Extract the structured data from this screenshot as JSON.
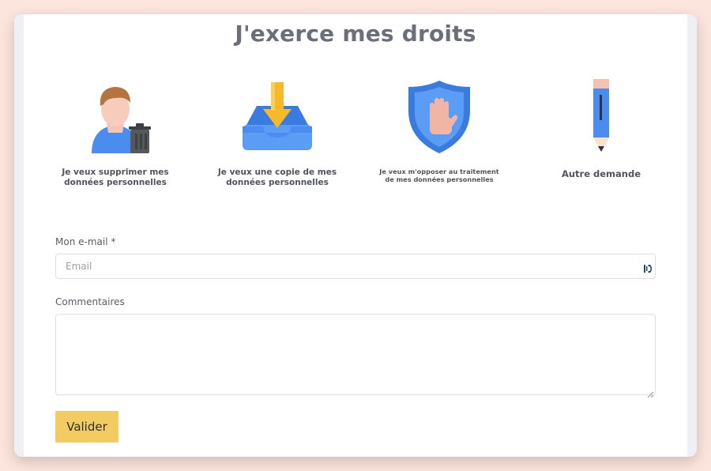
{
  "page": {
    "title": "J'exerce mes droits"
  },
  "options": [
    {
      "label_line1": "Je veux supprimer mes",
      "label_line2": "données personnelles",
      "icon": "delete-user-icon"
    },
    {
      "label_line1": "Je veux une copie de mes",
      "label_line2": "données personnelles",
      "icon": "download-tray-icon"
    },
    {
      "label_line1": "Je veux m'opposer au traitement",
      "label_line2": "de mes données personnelles",
      "icon": "stop-shield-icon"
    },
    {
      "label_line1": "Autre demande",
      "label_line2": "",
      "icon": "pencil-icon"
    }
  ],
  "form": {
    "email_label": "Mon e-mail *",
    "email_placeholder": "Email",
    "email_value": "",
    "comments_label": "Commentaires",
    "comments_value": "",
    "submit_label": "Valider"
  },
  "colors": {
    "background": "#fbe5dc",
    "accent_button": "#f2cb63",
    "icon_blue": "#4a8cf0",
    "icon_yellow": "#f7b928",
    "title_gray": "#6a6f78"
  }
}
